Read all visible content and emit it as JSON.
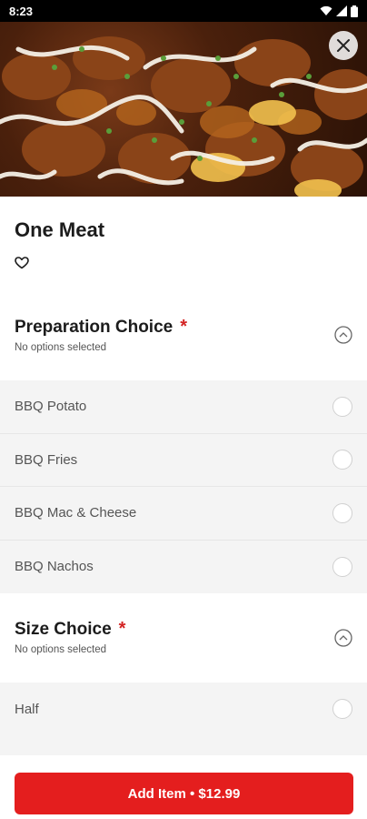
{
  "status_bar": {
    "time": "8:23",
    "icons": [
      "wifi-icon",
      "signal-icon",
      "battery-icon"
    ]
  },
  "hero": {
    "alt": "food photo",
    "close_icon": "close-icon"
  },
  "item": {
    "title": "One Meat",
    "favorite_icon": "heart-outline-icon"
  },
  "sections": [
    {
      "title": "Preparation Choice",
      "required_mark": "*",
      "subtitle": "No options selected",
      "options": [
        "BBQ Potato",
        "BBQ Fries",
        "BBQ Mac & Cheese",
        "BBQ Nachos"
      ]
    },
    {
      "title": "Size Choice",
      "required_mark": "*",
      "subtitle": "No options selected",
      "options": [
        "Half"
      ]
    }
  ],
  "cta": {
    "label": "Add Item • $12.99"
  },
  "colors": {
    "accent": "#e41e1e",
    "required": "#d32323",
    "option_bg": "#f4f4f4"
  }
}
